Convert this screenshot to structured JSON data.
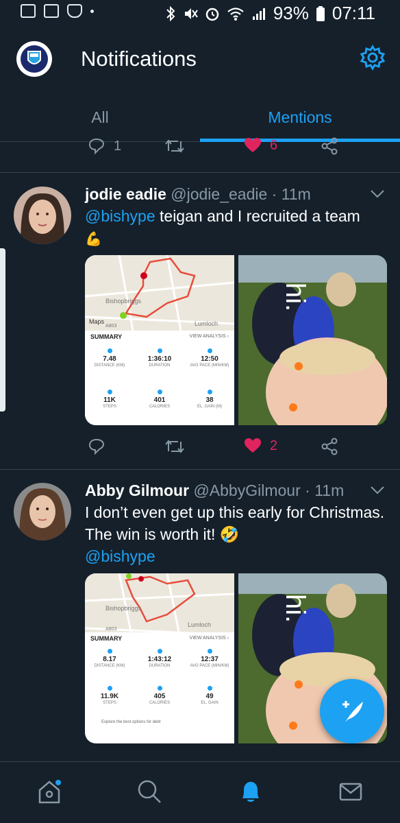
{
  "status_bar": {
    "battery": "93%",
    "time": "07:11"
  },
  "header": {
    "title": "Notifications"
  },
  "tabs": [
    {
      "label": "All"
    },
    {
      "label": "Mentions"
    }
  ],
  "top_actions": {
    "replies": "1",
    "likes": "6"
  },
  "tweets": [
    {
      "name": "jodie eadie",
      "handle": "@jodie_eadie",
      "time": "11m",
      "mention": "@bishype",
      "text": " teigan and I recruited a team",
      "emoji": "💪",
      "summary": {
        "title": "SUMMARY",
        "link": "VIEW ANALYSIS ›",
        "stats": [
          {
            "value": "7.48",
            "label": "DISTANCE (KM)"
          },
          {
            "value": "1:36:10",
            "label": "DURATION"
          },
          {
            "value": "12:50",
            "label": "AVG PACE (MIN/KM)"
          },
          {
            "value": "11K",
            "label": "STEPS"
          },
          {
            "value": "401",
            "label": "CALORIES"
          },
          {
            "value": "38",
            "label": "EL. GAIN (M)"
          }
        ],
        "map_labels": {
          "town": "Bishopbriggs",
          "lumloch": "Lumloch",
          "maps": "Maps",
          "road": "A803"
        }
      },
      "likes": "2"
    },
    {
      "name": "Abby Gilmour",
      "handle": "@AbbyGilmour",
      "time": "11m",
      "text": "I don’t even get up this early for Christmas. The win is worth it! 🤣",
      "mention": "@bishype",
      "summary": {
        "title": "SUMMARY",
        "link": "VIEW ANALYSIS ›",
        "stats": [
          {
            "value": "8.17",
            "label": "DISTANCE (KM)"
          },
          {
            "value": "1:43:12",
            "label": "DURATION"
          },
          {
            "value": "12:37",
            "label": "AVG PACE (MIN/KM)"
          },
          {
            "value": "11.9K",
            "label": "STEPS"
          },
          {
            "value": "405",
            "label": "CALORIES"
          },
          {
            "value": "49",
            "label": "EL. GAIN"
          }
        ],
        "map_labels": {
          "town": "Bishopbriggs",
          "lumloch": "Lumloch",
          "road": "A803"
        },
        "footer": "Explore the best options for debt"
      }
    }
  ],
  "colors": {
    "background": "#15202b",
    "accent": "#1da1f2",
    "like": "#e0245e",
    "muted": "#8899a6"
  },
  "icons": [
    "reply-icon",
    "retweet-icon",
    "like-icon",
    "share-icon",
    "gear-icon",
    "home-icon",
    "search-icon",
    "bell-icon",
    "mail-icon",
    "compose-icon"
  ]
}
